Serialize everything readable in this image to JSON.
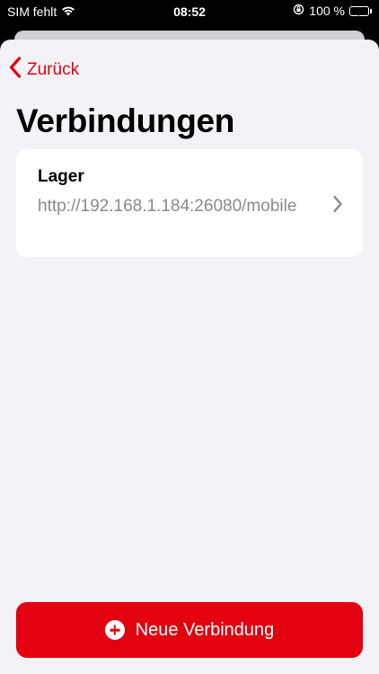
{
  "status_bar": {
    "carrier": "SIM fehlt",
    "time": "08:52",
    "battery_percent": "100 %",
    "icons": [
      "wifi-icon",
      "orientation-lock-icon",
      "battery-charging-icon"
    ],
    "battery_color": "#34c759"
  },
  "nav": {
    "back_label": "Zurück",
    "back_icon": "chevron-left-icon"
  },
  "page": {
    "title": "Verbindungen"
  },
  "connections": [
    {
      "name": "Lager",
      "url": "http://192.168.1.184:26080/mobile",
      "icon": "chevron-right-icon"
    }
  ],
  "footer": {
    "new_connection_label": "Neue Verbindung",
    "new_connection_icon": "plus-circle-icon"
  },
  "colors": {
    "accent": "#e3000f",
    "background": "#f2f2f7",
    "card": "#ffffff",
    "secondary_text": "#8a8a8e"
  }
}
